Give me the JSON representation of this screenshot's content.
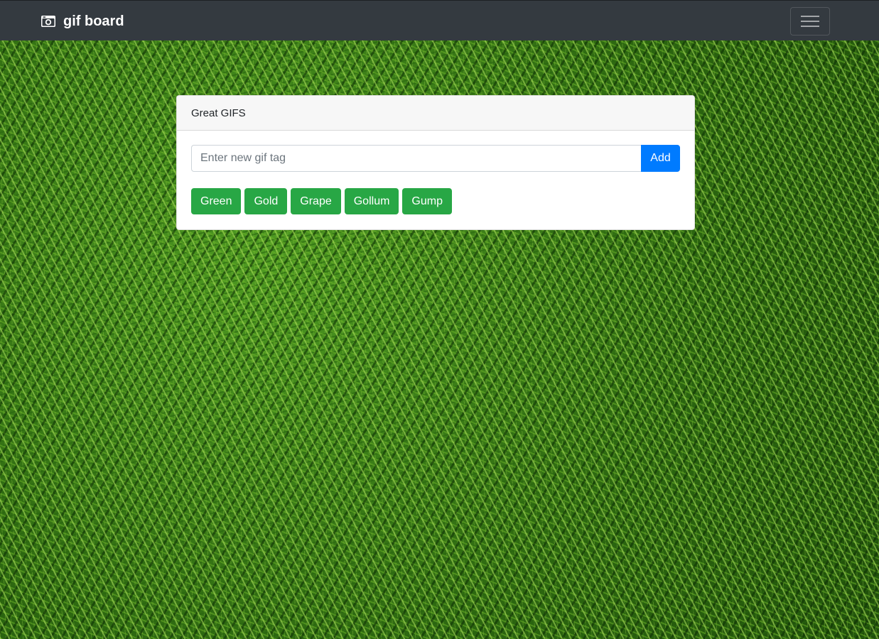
{
  "navbar": {
    "brand": "gif board",
    "brand_icon": "camera-icon",
    "toggler_icon": "hamburger-menu-icon",
    "background_color": "#343a40"
  },
  "card": {
    "header": "Great GIFS",
    "input": {
      "value": "",
      "placeholder": "Enter new gif tag"
    },
    "add_label": "Add",
    "tags": [
      {
        "label": "Green"
      },
      {
        "label": "Gold"
      },
      {
        "label": "Grape"
      },
      {
        "label": "Gollum"
      },
      {
        "label": "Gump"
      }
    ]
  },
  "colors": {
    "primary": "#007bff",
    "success": "#28a745",
    "background": "grass-texture"
  }
}
